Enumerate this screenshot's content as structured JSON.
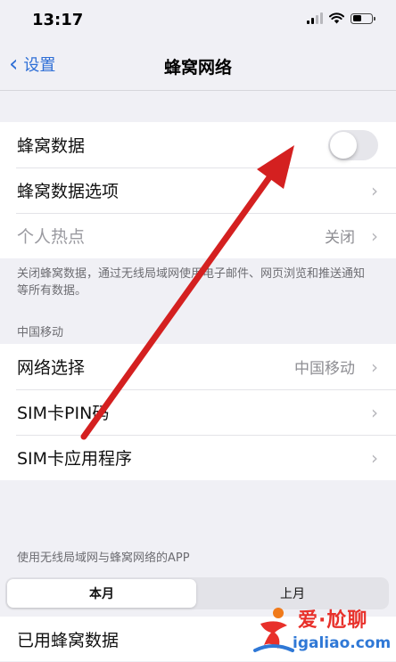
{
  "status_bar": {
    "time": "13:17"
  },
  "nav": {
    "back_label": "设置",
    "title": "蜂窝网络"
  },
  "group1": {
    "cellular_data_label": "蜂窝数据",
    "cellular_data_on": false,
    "cellular_data_options_label": "蜂窝数据选项",
    "hotspot_label": "个人热点",
    "hotspot_value": "关闭"
  },
  "footnote": {
    "text": "关闭蜂窝数据，通过无线局域网使用电子邮件、网页浏览和推送通知等所有数据。"
  },
  "carrier_section": {
    "header": "中国移动",
    "network_selection_label": "网络选择",
    "network_selection_value": "中国移动",
    "sim_pin_label": "SIM卡PIN码",
    "sim_apps_label": "SIM卡应用程序"
  },
  "usage_section": {
    "header": "使用无线局域网与蜂窝网络的APP",
    "tab_this_month": "本月",
    "tab_last_month": "上月",
    "used_data_label": "已用蜂窝数据"
  },
  "watermark": {
    "brand": "爱·尬聊",
    "domain": "igaliao.com"
  },
  "colors": {
    "accent": "#2f6fd6",
    "arrow": "#d42020",
    "background": "#f0f0f5"
  }
}
